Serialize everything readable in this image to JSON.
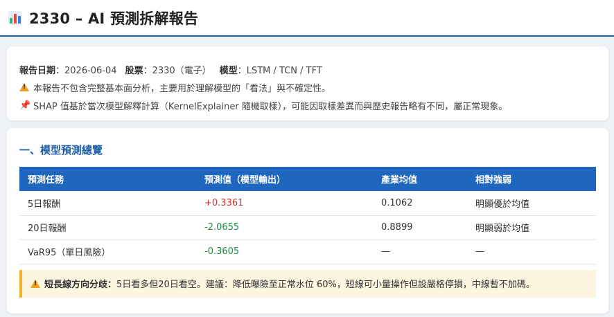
{
  "header": {
    "title": "2330 – AI 預測拆解報告",
    "icon": "bar-chart-icon",
    "accent": "#1e5fa8"
  },
  "meta": {
    "date_label": "報告日期",
    "date_value": "：2026-06-04",
    "stock_label": "股票",
    "stock_value": "：2330（電子）",
    "model_label": "模型",
    "model_value": "：LSTM / TCN / TFT",
    "disclaimer": "本報告不包含完整基本面分析，主要用於理解模型的「看法」與不確定性。",
    "shap_note": "SHAP 值基於當次模型解釋計算（KernelExplainer 隨機取樣），可能因取樣差異而與歷史報告略有不同，屬正常現象。"
  },
  "overview": {
    "title": "一、模型預測總覽",
    "columns": [
      "預測任務",
      "預測值（模型輸出）",
      "產業均值",
      "相對強弱"
    ],
    "rows": [
      {
        "task": "5日報酬",
        "prediction": "+0.3361",
        "industry_avg": "0.1062",
        "relative": "明顯優於均值",
        "tone": "pos"
      },
      {
        "task": "20日報酬",
        "prediction": "-2.0655",
        "industry_avg": "0.8899",
        "relative": "明顯弱於均值",
        "tone": "neg"
      },
      {
        "task": "VaR95（單日風險）",
        "prediction": "-0.3605",
        "industry_avg": "—",
        "relative": "—",
        "tone": "neg"
      }
    ],
    "alert_label": "短長線方向分歧：",
    "alert_text": "5日看多但20日看空。建議：降低曝險至正常水位 60%，短線可小量操作但設嚴格停損，中線暫不加碼。"
  },
  "colors": {
    "positive": "#c8332e",
    "negative": "#1f8a45",
    "table_header": "#1f66be",
    "alert_bg": "#fdf5e0",
    "alert_border": "#f0b429"
  }
}
